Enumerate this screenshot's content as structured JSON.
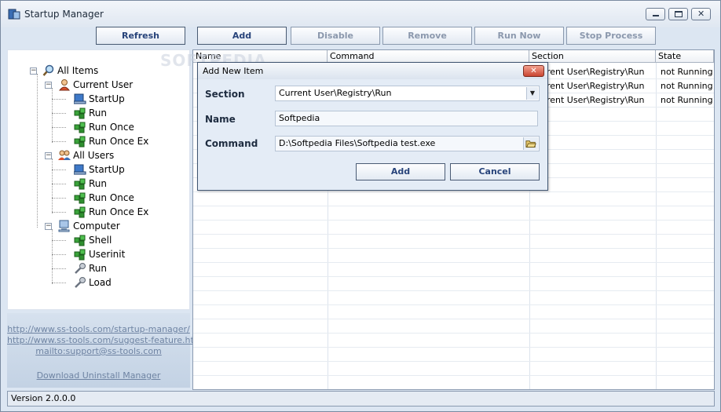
{
  "window": {
    "title": "Startup Manager"
  },
  "toolbar": {
    "refresh": "Refresh",
    "add": "Add",
    "disable": "Disable",
    "remove": "Remove",
    "run_now": "Run Now",
    "stop_process": "Stop Process"
  },
  "tree": {
    "all_items": "All Items",
    "current_user": "Current User",
    "cu_startup": "StartUp",
    "cu_run": "Run",
    "cu_run_once": "Run Once",
    "cu_run_once_ex": "Run Once Ex",
    "all_users": "All Users",
    "au_startup": "StartUp",
    "au_run": "Run",
    "au_run_once": "Run Once",
    "au_run_once_ex": "Run Once Ex",
    "computer": "Computer",
    "shell": "Shell",
    "userinit": "Userinit",
    "pc_run": "Run",
    "load": "Load"
  },
  "links": {
    "startup_manager": "http://www.ss-tools.com/startup-manager/",
    "suggest_feature": "http://www.ss-tools.com/suggest-feature.html",
    "mailto": "mailto:support@ss-tools.com",
    "download_uninstall": "Download Uninstall Manager"
  },
  "grid": {
    "columns": [
      "Name",
      "Command",
      "Section",
      "State"
    ],
    "rows": [
      {
        "section": "Current User\\Registry\\Run",
        "state": "not Running"
      },
      {
        "section": "Current User\\Registry\\Run",
        "state": "not Running"
      },
      {
        "section": "Current User\\Registry\\Run",
        "state": "not Running"
      }
    ]
  },
  "dialog": {
    "title": "Add New Item",
    "section_label": "Section",
    "section_value": "Current User\\Registry\\Run",
    "name_label": "Name",
    "name_value": "Softpedia",
    "command_label": "Command",
    "command_value": "D:\\Softpedia Files\\Softpedia test.exe",
    "add": "Add",
    "cancel": "Cancel"
  },
  "status": {
    "version": "Version 2.0.0.0"
  },
  "watermark": "SOFTPEDIA"
}
